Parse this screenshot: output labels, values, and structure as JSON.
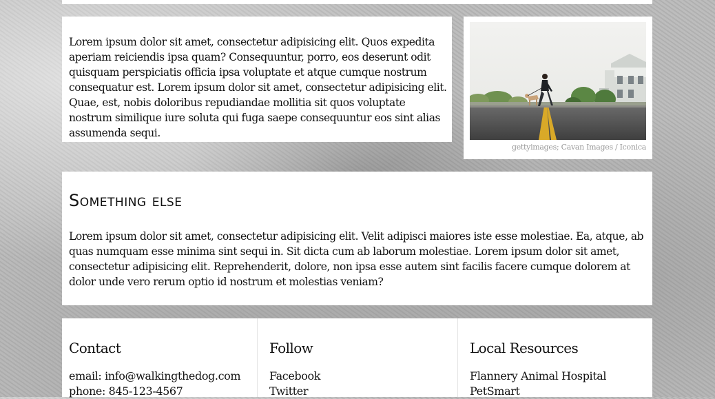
{
  "intro": {
    "text": "Lorem ipsum dolor sit amet, consectetur adipisicing elit. Quos expedita aperiam reiciendis ipsa quam? Consequuntur, porro, eos deserunt odit quisquam perspiciatis officia ipsa voluptate et atque cumque nostrum consequatur est. Lorem ipsum dolor sit amet, consectetur adipisicing elit. Quae, est, nobis doloribus repudiandae mollitia sit quos voluptate nostrum similique iure soluta qui fuga saepe consequuntur eos sint alias assumenda sequi."
  },
  "photo": {
    "caption": "gettyimages; Cavan Images / Iconica"
  },
  "section": {
    "title": "Something else",
    "text": "Lorem ipsum dolor sit amet, consectetur adipisicing elit. Velit adipisci maiores iste esse molestiae. Ea, atque, ab quas numquam esse minima sint sequi in. Sit dicta cum ab laborum molestiae. Lorem ipsum dolor sit amet, consectetur adipisicing elit. Reprehenderit, dolore, non ipsa esse autem sint facilis facere cumque dolorem at dolor unde vero rerum optio id nostrum et molestias veniam?"
  },
  "footer": {
    "contact": {
      "heading": "Contact",
      "email": "email: info@walkingthedog.com",
      "phone": "phone: 845-123-4567"
    },
    "follow": {
      "heading": "Follow",
      "links": [
        "Facebook",
        "Twitter"
      ]
    },
    "resources": {
      "heading": "Local Resources",
      "links": [
        "Flannery Animal Hospital",
        "PetSmart"
      ]
    }
  }
}
